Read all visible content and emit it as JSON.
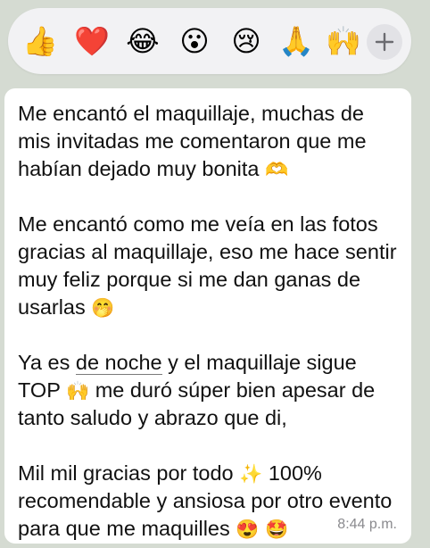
{
  "reactions": [
    {
      "name": "thumbs-up",
      "glyph": "👍"
    },
    {
      "name": "red-heart",
      "glyph": "❤️"
    },
    {
      "name": "tears-of-joy",
      "glyph": "😂"
    },
    {
      "name": "surprised-face",
      "glyph": "😮"
    },
    {
      "name": "crying-face",
      "glyph": "😢"
    },
    {
      "name": "folded-hands",
      "glyph": "🙏"
    },
    {
      "name": "raising-hand",
      "glyph": "🙌"
    }
  ],
  "add_reaction": {
    "icon": "plus-icon"
  },
  "message": {
    "p1": {
      "text": "Me encantó el maquillaje, muchas de mis invitadas me comentaron que me habían dejado muy bonita",
      "emoji": "🫶"
    },
    "p2": {
      "text": "Me encantó como me veía en las fotos gracias al maquillaje, eso me hace sentir muy feliz porque si me dan ganas de usarlas",
      "emoji": "🤭"
    },
    "p3": {
      "before": "Ya es",
      "link": "de noche",
      "middle": "y el maquillaje sigue TOP",
      "emoji": "🙌",
      "after": "me duró súper bien apesar de tanto saludo y abrazo que di,"
    },
    "p4": {
      "before": "Mil mil gracias por todo",
      "emoji1": "✨",
      "after": "100% recomendable y ansiosa por otro evento para que me maquilles",
      "emoji2": "😍",
      "emoji3": "🤩"
    },
    "timestamp": "8:44 p.m."
  },
  "colors": {
    "chat_background": "#d5dbd2",
    "bubble": "#ffffff",
    "reaction_bar": "#f2f2f4",
    "timestamp": "#8a8a8e"
  }
}
